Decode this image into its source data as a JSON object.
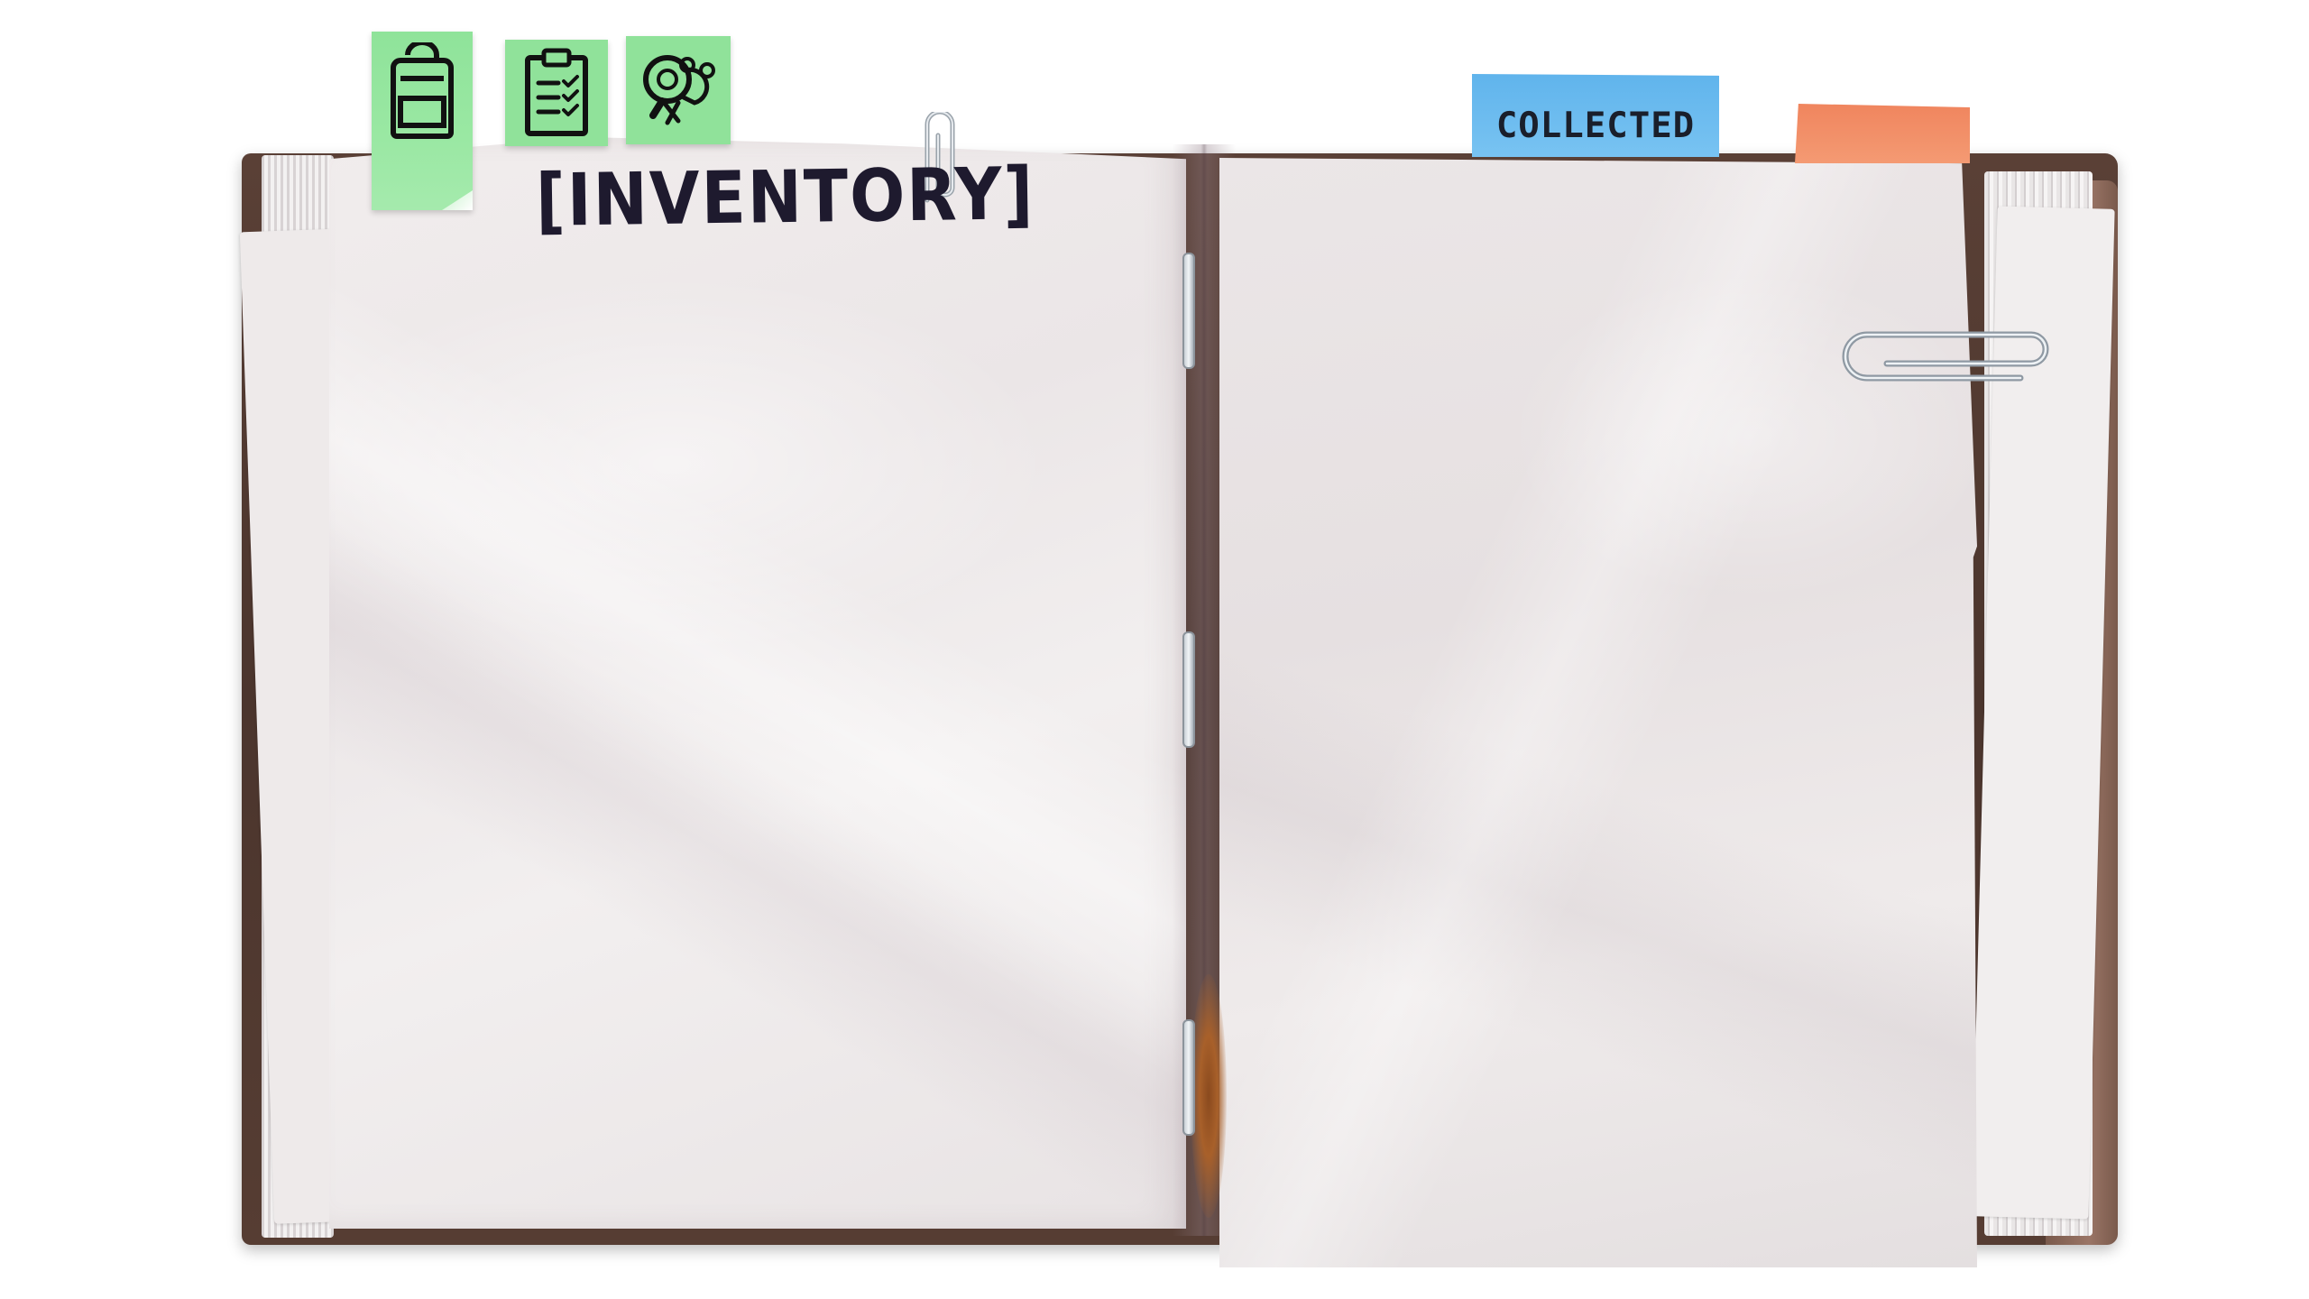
{
  "journal": {
    "section_title": "INVENTORY",
    "open_bracket": "[",
    "close_bracket": "]"
  },
  "tabs": [
    {
      "id": "inventory",
      "icon": "backpack-icon",
      "active": true,
      "color": "#90e29a"
    },
    {
      "id": "objectives",
      "icon": "clipboard-checklist-icon",
      "active": false,
      "color": "#90e29a"
    },
    {
      "id": "collectibles",
      "icon": "magnifier-teddy-bear-icon",
      "active": false,
      "color": "#90e29a"
    }
  ],
  "page_tabs": {
    "collected_label": "COLLECTED",
    "collected_color": "#6cbcee",
    "second_tab_color": "#f28c66"
  },
  "colors": {
    "cover": "#4b352d",
    "page": "#ede8e9",
    "title_ink": "#1e1a2e"
  }
}
